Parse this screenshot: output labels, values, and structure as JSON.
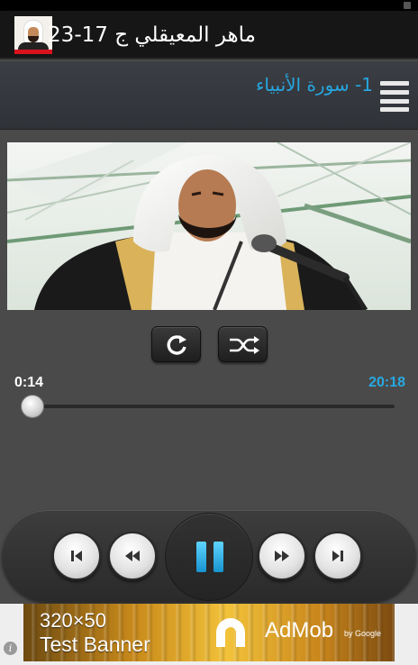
{
  "app": {
    "title": "ماهر المعيقلي ج 17-23",
    "icon": "sheikh-portrait-icon"
  },
  "track": {
    "title": "1- سورة الأنبياء",
    "menu_icon": "hamburger-menu-icon"
  },
  "artwork": {
    "description_icon": "reciter-photo"
  },
  "playback": {
    "current_time": "0:14",
    "total_time": "20:18",
    "progress_fraction": 0.0115,
    "repeat_icon": "repeat-icon",
    "shuffle_icon": "shuffle-icon"
  },
  "controls": {
    "prev_icon": "skip-previous-icon",
    "rewind_icon": "rewind-icon",
    "play_pause_icon": "pause-icon",
    "fast_forward_icon": "fast-forward-icon",
    "next_icon": "skip-next-icon"
  },
  "ad": {
    "size_label": "320×50",
    "text": "Test Banner",
    "brand": "AdMob",
    "brand_sub": "by Google",
    "info_icon": "i"
  },
  "colors": {
    "accent": "#28a9e1",
    "background": "#4a4a4a",
    "action_bar": "#161616"
  }
}
